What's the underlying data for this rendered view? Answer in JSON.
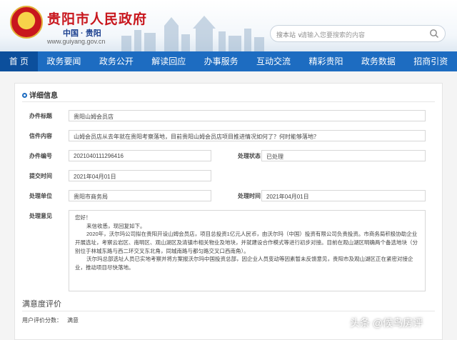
{
  "header": {
    "site_title": "贵阳市人民政府",
    "site_sub": "中国 · 贵阳",
    "site_url": "www.guiyang.gov.cn",
    "search_prefix": "搜本站 ∨",
    "search_placeholder": "请输入您要搜索的内容"
  },
  "nav": {
    "items": [
      "首 页",
      "政务要闻",
      "政务公开",
      "解读回应",
      "办事服务",
      "互动交流",
      "精彩贵阳",
      "政务数据",
      "招商引资"
    ],
    "active_index": 0
  },
  "panel": {
    "title": "详细信息",
    "fields": {
      "subject_label": "办件标题",
      "subject_value": "贵阳山姆会员店",
      "content_label": "信件内容",
      "content_value": "山姆会员店从去年就在贵阳考察落地，目前贵阳山姆会员店项目推进情况如何了？何时能够落地？",
      "number_label": "办件编号",
      "number_value": "2021040111296416",
      "status_label": "处理状态",
      "status_value": "已处理",
      "submit_label": "提交时间",
      "submit_value": "2021年04月01日",
      "unit_label": "处理单位",
      "unit_value": "贵阳市商务局",
      "handle_time_label": "处理时间",
      "handle_time_value": "2021年04月01日",
      "opinion_label": "处理意见"
    },
    "opinion": {
      "greeting": "您好！",
      "p1": "来信收悉，现回复如下。",
      "p2": "2020年，沃尔玛公司拟在贵阳开设山姆会员店，项目总投资1亿元人民币，由沃尔玛（中国）投资有限公司负责投资。市商务局积极协助企业开展选址，考察云岩区、南明区、观山湖区及清镇市相关物业及地块，并就建设合作模式等进行初步对接。目前在观山湖区明确两个备选地块（分别位于林城东路与西二环交叉东北角，同城南路与都匀路交叉口西南角）。",
      "p3": "沃尔玛总部选址人员已实地考察并将方案报沃尔玛中国投资总部，因企业人员变动等因素暂未反馈意见，贵阳市及观山湖区正在紧密对接企业，推动项目尽快落地。"
    },
    "satisfaction": {
      "title": "满意度评价",
      "score_label": "用户评价分数：",
      "score_value": "满意"
    }
  },
  "watermark": "头条 @候鸟房评",
  "colors": {
    "nav_bg": "#1d6cc1",
    "nav_active": "#0c4f9c",
    "title_red": "#c8161d"
  }
}
